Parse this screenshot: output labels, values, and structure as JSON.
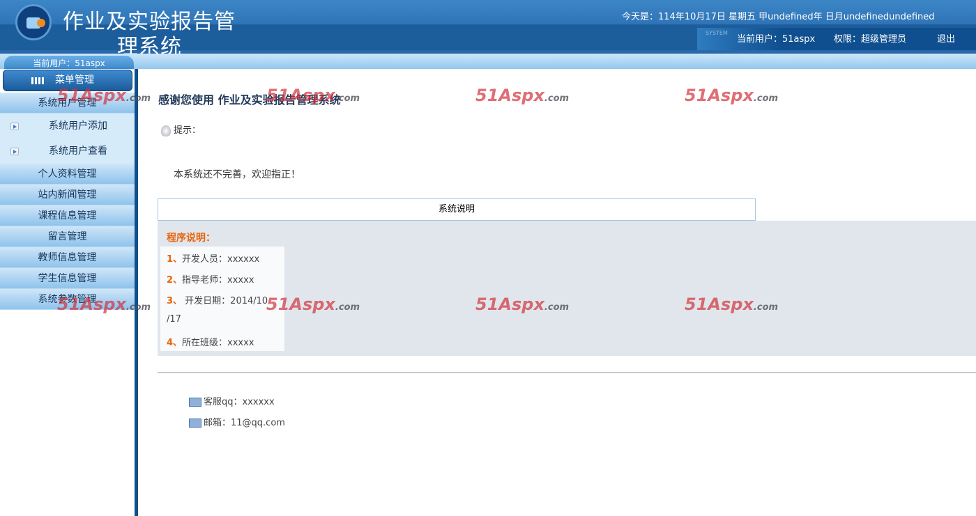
{
  "header": {
    "title_line1": "作业及实验报告管",
    "title_line2": "理系统",
    "today": "今天是：114年10月17日 星期五 甲undefined年 日月undefinedundefined",
    "system_badge": "SYSTEM",
    "current_user": "当前用户：51aspx",
    "role": "权限：超级管理员",
    "logout": "退出"
  },
  "sidebar": {
    "user_pill": "当前用户：51aspx",
    "menu_title": "菜单管理",
    "items": [
      {
        "label": "系统用户管理"
      },
      {
        "label": "系统用户添加"
      },
      {
        "label": "系统用户查看"
      },
      {
        "label": "个人资料管理"
      },
      {
        "label": "站内新闻管理"
      },
      {
        "label": "课程信息管理"
      },
      {
        "label": "留言管理"
      },
      {
        "label": "教师信息管理"
      },
      {
        "label": "学生信息管理"
      },
      {
        "label": "系统参数管理"
      }
    ]
  },
  "main": {
    "welcome": "感谢您使用 作业及实验报告管理系统",
    "tip": "提示：",
    "notice": "本系统还不完善，欢迎指正！",
    "box_title": "系统说明",
    "program_title": "程序说明：",
    "lines": [
      {
        "num": "1、",
        "text": "开发人员：xxxxxx"
      },
      {
        "num": "2、",
        "text": "指导老师：xxxxx"
      },
      {
        "num": "3、",
        "text": " 开发日期：2014/10"
      },
      {
        "num": "",
        "text": "/17"
      },
      {
        "num": "4、",
        "text": "所在班级：xxxxx"
      }
    ],
    "contact_qq": "客服qq：xxxxxx",
    "contact_email": "邮箱：11@qq.com"
  },
  "watermark": {
    "brand": "51Aspx",
    "suffix": ".com"
  }
}
